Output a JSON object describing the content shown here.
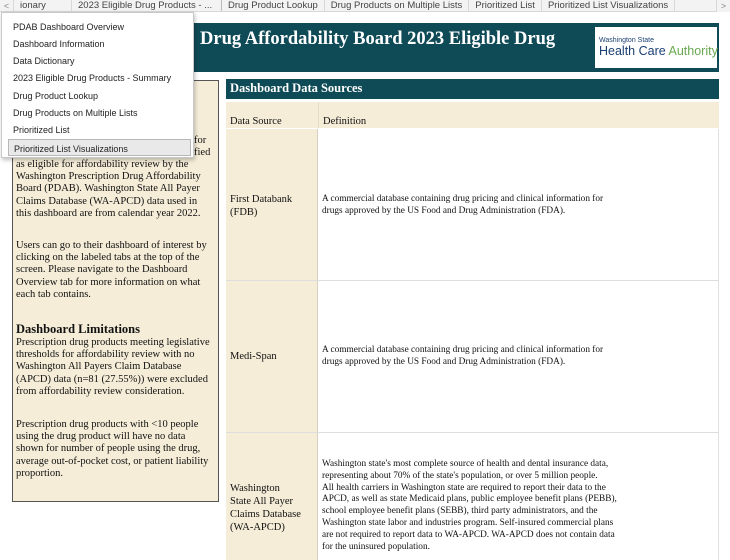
{
  "tabs": {
    "left_arrow": "<",
    "right_arrow": ">",
    "items": [
      {
        "label": "ionary"
      },
      {
        "label": "2023 Eligible Drug Products - ..."
      },
      {
        "label": "Drug Product Lookup"
      },
      {
        "label": "Drug Products on Multiple Lists"
      },
      {
        "label": "Prioritized List"
      },
      {
        "label": "Prioritized List Visualizations"
      }
    ]
  },
  "header": {
    "title": "Drug Affordability Board 2023 Eligible Drug",
    "logo_line1": "Washington State",
    "logo_line2_a": "Health Care ",
    "logo_line2_b": "Authority"
  },
  "menu": {
    "items": [
      {
        "label": "PDAB Dashboard Overview"
      },
      {
        "label": "Dashboard Information"
      },
      {
        "label": "Data Dictionary"
      },
      {
        "label": "2023 Eligible Drug Products - Summary"
      },
      {
        "label": "Drug Product Lookup"
      },
      {
        "label": "Drug Products on Multiple Lists"
      },
      {
        "label": "Prioritized List"
      },
      {
        "label": "Prioritized List Visualizations"
      }
    ]
  },
  "left_panel": {
    "frag_for": "for",
    "frag_fied": "fied",
    "intro_lines": [
      "as eligible for affordability review by the",
      "Washington Prescription Drug Affordability",
      "Board (PDAB). Washington State All Payer",
      "Claims Database (WA-APCD) data used in",
      "this dashboard are from calendar year 2022."
    ],
    "nav_lines": [
      "Users can go to their dashboard of interest by",
      "clicking on the labeled tabs at the top of the",
      "screen. Please navigate to the Dashboard",
      "Overview tab for more information on what",
      "each tab contains."
    ],
    "limitations_heading": "Dashboard Limitations",
    "limit1_lines": [
      "Prescription drug products meeting legislative",
      "thresholds for affordability review with no",
      "Washington All Payers Claim Database",
      "(APCD) data (n=81 (27.55%)) were excluded",
      "from affordability review consideration."
    ],
    "limit2_lines": [
      "Prescription drug products with <10 people",
      "using the drug product will have no data",
      "shown for number of people using the drug,",
      "average out-of-pocket cost, or patient liability",
      "proportion."
    ]
  },
  "sources": {
    "title": "Dashboard Data Sources",
    "col_source": "Data Source",
    "col_definition": "Definition",
    "rows": [
      {
        "source_lines": [
          "First Databank",
          "(FDB)"
        ],
        "definition_lines": [
          "A commercial database containing drug pricing and clinical information for",
          "drugs approved by the US Food and Drug Administration (FDA)."
        ]
      },
      {
        "source_lines": [
          "Medi-Span"
        ],
        "definition_lines": [
          "A commercial database containing drug pricing and clinical information for",
          "drugs approved by the US Food and Drug Administration (FDA)."
        ]
      },
      {
        "source_lines": [
          "Washington",
          "State All Payer",
          "Claims Database",
          "(WA-APCD)"
        ],
        "definition_lines": [
          "Washington state's most complete source of health and dental insurance data,",
          "representing about 70% of the state's population, or over 5 million people.",
          "All health carriers in Washington state are required to report their data to the",
          "APCD, as well as state Medicaid plans, public employee benefit plans (PEBB),",
          "school employee benefit plans (SEBB), third party administrators, and the",
          "Washington state labor and industries program. Self-insured commercial plans",
          "are not required to report data to WA-APCD. WA-APCD does not contain data",
          "for the uninsured population."
        ]
      }
    ]
  }
}
